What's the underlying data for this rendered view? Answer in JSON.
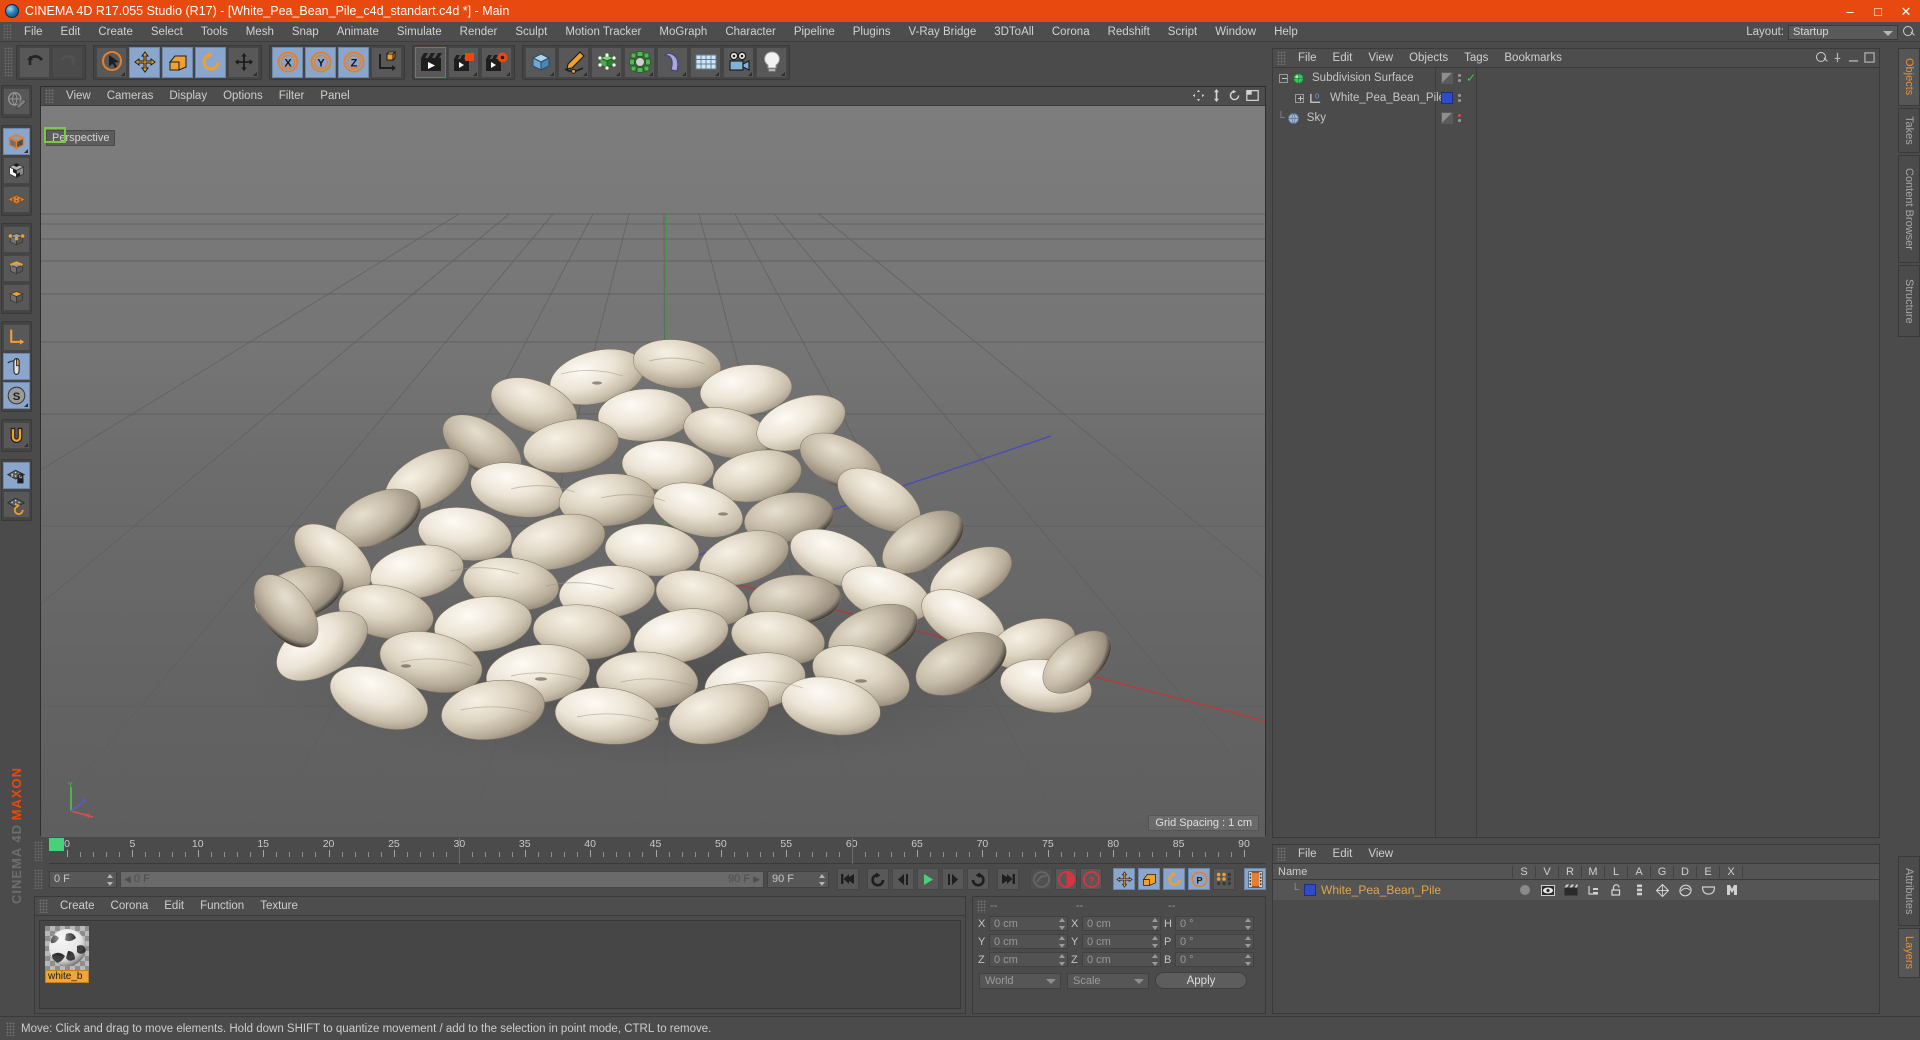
{
  "window": {
    "title": "CINEMA 4D R17.055 Studio (R17) - [White_Pea_Bean_Pile_c4d_standart.c4d *] - Main",
    "app_icon": "c4d-logo-icon",
    "minimize": "–",
    "maximize": "□",
    "close": "✕",
    "accent_color": "#e8490f"
  },
  "menubar": {
    "items": [
      "File",
      "Edit",
      "Create",
      "Select",
      "Tools",
      "Mesh",
      "Snap",
      "Animate",
      "Simulate",
      "Render",
      "Sculpt",
      "Motion Tracker",
      "MoGraph",
      "Character",
      "Pipeline",
      "Plugins",
      "V-Ray Bridge",
      "3DToAll",
      "Corona",
      "Redshift",
      "Script",
      "Window",
      "Help"
    ],
    "layout_label": "Layout:",
    "layout_value": "Startup",
    "search_icon": "search-icon"
  },
  "toolbar": {
    "groups": [
      {
        "name": "undo-redo",
        "buttons": [
          {
            "icon": "undo-icon",
            "state": "normal"
          },
          {
            "icon": "redo-icon",
            "state": "disabled"
          }
        ]
      },
      {
        "name": "transform-tools",
        "buttons": [
          {
            "icon": "select-live-icon",
            "state": "normal",
            "corner": true
          },
          {
            "icon": "move-icon",
            "state": "active"
          },
          {
            "icon": "scale-icon",
            "state": "active"
          },
          {
            "icon": "rotate-icon",
            "state": "active"
          },
          {
            "icon": "move-tool-icon",
            "state": "normal",
            "corner": true
          }
        ]
      },
      {
        "name": "axis-locks",
        "buttons": [
          {
            "icon": "axis-x-icon",
            "state": "active"
          },
          {
            "icon": "axis-y-icon",
            "state": "active"
          },
          {
            "icon": "axis-z-icon",
            "state": "active"
          },
          {
            "icon": "world-coord-icon",
            "state": "normal"
          }
        ]
      },
      {
        "name": "render-tools",
        "buttons": [
          {
            "icon": "render-view-icon",
            "state": "framed"
          },
          {
            "icon": "render-to-picture-icon",
            "state": "normal",
            "corner": true
          },
          {
            "icon": "render-settings-icon",
            "state": "normal",
            "corner": true
          }
        ]
      },
      {
        "name": "create-objects",
        "buttons": [
          {
            "icon": "cube-primitive-icon",
            "state": "normal",
            "corner": true
          },
          {
            "icon": "spline-pen-icon",
            "state": "normal",
            "corner": true
          },
          {
            "icon": "nurbs-generator-icon",
            "state": "normal",
            "corner": true
          },
          {
            "icon": "array-modeling-icon",
            "state": "normal",
            "corner": true
          },
          {
            "icon": "deformer-bend-icon",
            "state": "normal",
            "corner": true
          },
          {
            "icon": "floor-environment-icon",
            "state": "normal",
            "corner": true
          },
          {
            "icon": "camera-icon",
            "state": "normal",
            "corner": true
          },
          {
            "icon": "light-icon",
            "state": "normal",
            "corner": true
          }
        ]
      }
    ]
  },
  "left_toolbar": {
    "buttons": [
      {
        "icon": "make-editable-icon",
        "state": "normal"
      },
      {
        "icon": "model-mode-icon",
        "state": "active",
        "corner": true
      },
      {
        "icon": "texture-mode-icon",
        "state": "normal"
      },
      {
        "icon": "workplane-mode-icon",
        "state": "normal"
      },
      {
        "icon": "point-mode-icon",
        "state": "normal"
      },
      {
        "icon": "edge-mode-icon",
        "state": "normal"
      },
      {
        "icon": "polygon-mode-icon",
        "state": "normal"
      },
      {
        "icon": "object-axis-icon",
        "state": "normal"
      },
      {
        "icon": "viewport-solo-icon",
        "state": "active"
      },
      {
        "icon": "enable-snap-icon",
        "state": "active",
        "corner": true
      },
      {
        "icon": "magnet-tool-icon",
        "state": "normal",
        "corner": true
      },
      {
        "icon": "workplane-lock-icon",
        "state": "active"
      },
      {
        "icon": "workplane-align-icon",
        "state": "normal"
      }
    ],
    "brand_line1": "MAXON",
    "brand_line2": "CINEMA 4D"
  },
  "viewport": {
    "menu": [
      "View",
      "Cameras",
      "Display",
      "Options",
      "Filter",
      "Panel"
    ],
    "label": "Perspective",
    "grid_spacing": "Grid Spacing : 1 cm",
    "corner_icons": [
      "pan-view-icon",
      "move-view-icon",
      "rotate-view-icon",
      "maximize-view-icon"
    ],
    "axis_labels": {
      "x": "X",
      "y": "Y",
      "z": "Z"
    },
    "scene_description": "White pea bean pile 3D model rendered on a grey gradient ground plane with perspective grid"
  },
  "timeline": {
    "start_frame_marker": 0,
    "ticks": [
      0,
      5,
      10,
      15,
      20,
      25,
      30,
      35,
      40,
      45,
      50,
      55,
      60,
      65,
      70,
      75,
      80,
      85,
      90
    ],
    "playhead_positions": [
      30,
      60
    ],
    "min_frame": "0 F",
    "max_frame": "90 F",
    "current_frame": "0 F",
    "range_left": "0 F",
    "range_right": "90 F",
    "end_field": "90 F",
    "preview_field": "0 F"
  },
  "transport": {
    "buttons": [
      {
        "icon": "go-to-start-icon",
        "state": "normal"
      },
      {
        "icon": "previous-keyframe-icon",
        "state": "normal"
      },
      {
        "icon": "step-back-icon",
        "state": "normal"
      },
      {
        "icon": "play-forward-icon",
        "state": "normal"
      },
      {
        "icon": "step-forward-icon",
        "state": "normal"
      },
      {
        "icon": "next-keyframe-icon",
        "state": "normal"
      },
      {
        "icon": "go-to-end-icon",
        "state": "normal"
      },
      {
        "icon": "record-active-objects-icon",
        "state": "disabled"
      },
      {
        "icon": "autokeying-icon",
        "state": "normal"
      },
      {
        "icon": "keyframe-selection-icon",
        "state": "normal"
      },
      {
        "icon": "key-position-icon",
        "state": "active"
      },
      {
        "icon": "key-scale-icon",
        "state": "active"
      },
      {
        "icon": "key-rotation-icon",
        "state": "active"
      },
      {
        "icon": "key-parameter-icon",
        "state": "active"
      },
      {
        "icon": "key-pla-icon",
        "state": "normal"
      },
      {
        "icon": "timeline-filmstrip-icon",
        "state": "active"
      }
    ]
  },
  "material_manager": {
    "menu": [
      "Create",
      "Corona",
      "Edit",
      "Function",
      "Texture"
    ],
    "materials": [
      {
        "name": "white_b",
        "thumbnail": "checker-sphere-preview",
        "selected": true
      }
    ]
  },
  "coordinates": {
    "header": [
      "--",
      "--",
      "--"
    ],
    "rows": [
      {
        "pos_label": "X",
        "pos_value": "0 cm",
        "size_label": "X",
        "size_value": "0 cm",
        "rot_label": "H",
        "rot_value": "0 °"
      },
      {
        "pos_label": "Y",
        "pos_value": "0 cm",
        "size_label": "Y",
        "size_value": "0 cm",
        "rot_label": "P",
        "rot_value": "0 °"
      },
      {
        "pos_label": "Z",
        "pos_value": "0 cm",
        "size_label": "Z",
        "size_value": "0 cm",
        "rot_label": "B",
        "rot_value": "0 °"
      }
    ],
    "system_select": "World",
    "mode_select": "Scale",
    "apply_label": "Apply"
  },
  "object_manager": {
    "menu": [
      "File",
      "Edit",
      "View",
      "Objects",
      "Tags",
      "Bookmarks"
    ],
    "objects": [
      {
        "name": "Subdivision Surface",
        "depth": 0,
        "expand": "minus",
        "icon": "subdivision-surface-icon",
        "tag": "check",
        "dots": 2
      },
      {
        "name": "White_Pea_Bean_Pile",
        "depth": 1,
        "expand": "plus",
        "icon": "null-object-icon",
        "tag": "blue-swatch",
        "dots": 2
      },
      {
        "name": "Sky",
        "depth": 0,
        "expand": "none",
        "icon": "sky-object-icon",
        "tag": "red-dot",
        "dots": 2
      }
    ],
    "corner_icons": [
      "search-icon",
      "pin-icon",
      "minimize-icon",
      "maximize-icon"
    ]
  },
  "layer_manager": {
    "menu": [
      "File",
      "Edit",
      "View"
    ],
    "columns": [
      "Name",
      "S",
      "V",
      "R",
      "M",
      "L",
      "A",
      "G",
      "D",
      "E",
      "X"
    ],
    "rows": [
      {
        "name": "White_Pea_Bean_Pile",
        "swatch_color": "#2d4cc8",
        "cells": [
          "solo-dot",
          "view-icon",
          "render-icon",
          "manager-icon",
          "lock-icon",
          "animation-icon",
          "generator-icon",
          "deformer-icon",
          "expression-icon",
          "xref-icon"
        ]
      }
    ]
  },
  "right_tabs_top": [
    {
      "label": "Objects",
      "active": true
    },
    {
      "label": "Takes",
      "active": false
    },
    {
      "label": "Content Browser",
      "active": false
    },
    {
      "label": "Structure",
      "active": false
    }
  ],
  "right_tabs_bottom": [
    {
      "label": "Attributes",
      "active": false
    },
    {
      "label": "Layers",
      "active": true
    }
  ],
  "statusbar": {
    "text": "Move: Click and drag to move elements. Hold down SHIFT to quantize movement / add to the selection in point mode, CTRL to remove."
  }
}
